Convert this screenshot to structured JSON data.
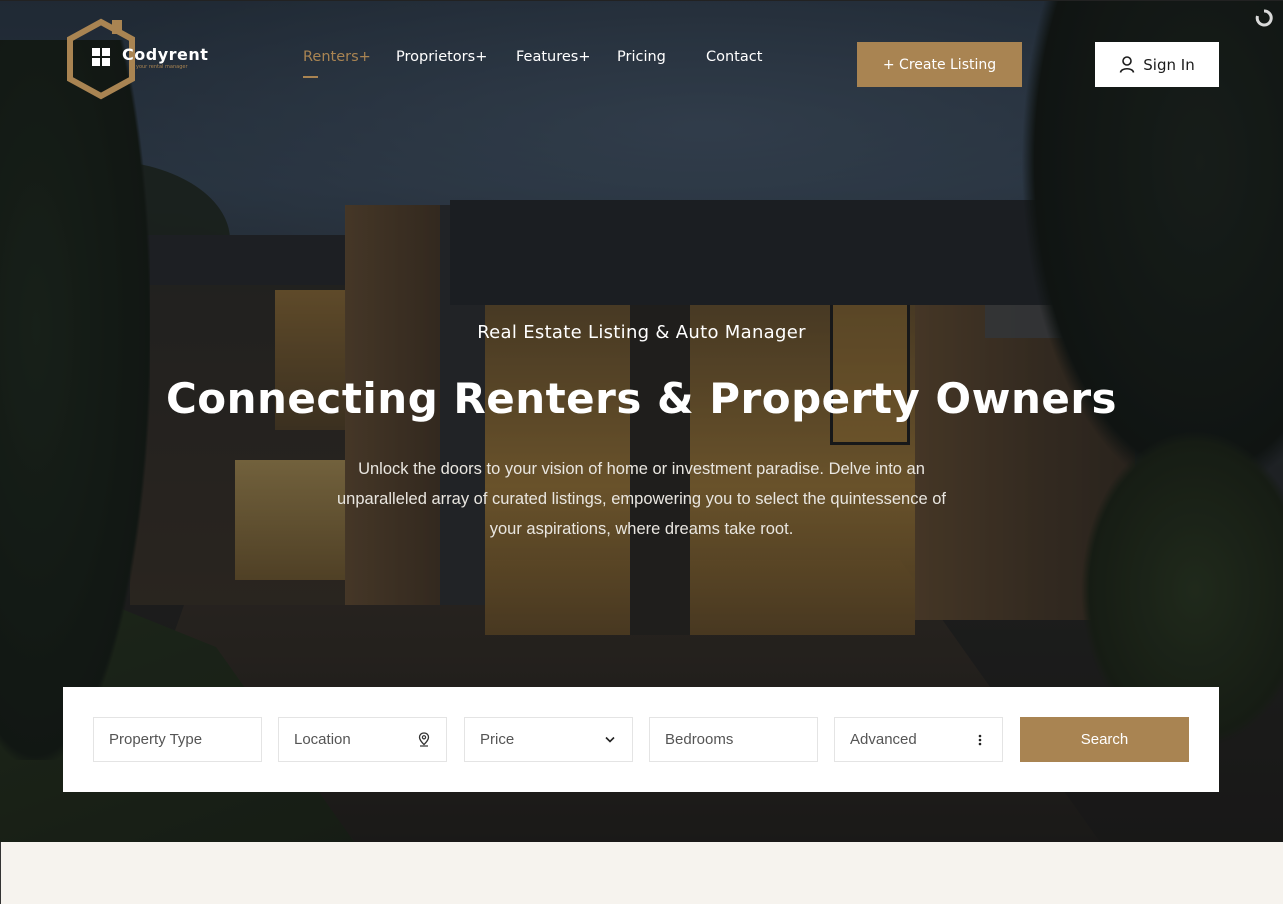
{
  "brand": {
    "name": "Codyrent",
    "tagline": "your rental manager",
    "accent_color": "#a98452"
  },
  "nav": {
    "items": [
      {
        "label": "Renters+",
        "active": true
      },
      {
        "label": "Proprietors+",
        "active": false
      },
      {
        "label": "Features+",
        "active": false
      },
      {
        "label": "Pricing",
        "active": false
      },
      {
        "label": "Contact",
        "active": false
      }
    ]
  },
  "header": {
    "create_listing_label": "+ Create Listing",
    "sign_in_label": "Sign In",
    "sign_in_icon": "user-icon",
    "loader_icon": "spinner-icon"
  },
  "hero": {
    "subtitle": "Real Estate Listing & Auto Manager",
    "title": "Connecting Renters & Property Owners",
    "description_lines": [
      "Unlock the doors to your vision of home or investment paradise. Delve into an",
      "unparalleled array of curated listings, empowering you to select the quintessence of",
      "your aspirations, where dreams take root."
    ]
  },
  "search": {
    "fields": [
      {
        "label": "Property Type",
        "icon": ""
      },
      {
        "label": "Location",
        "icon": "map-pin-icon"
      },
      {
        "label": "Price",
        "icon": "chevron-down-icon"
      },
      {
        "label": "Bedrooms",
        "icon": ""
      },
      {
        "label": "Advanced",
        "icon": "vertical-dots-icon"
      }
    ],
    "button_label": "Search"
  }
}
